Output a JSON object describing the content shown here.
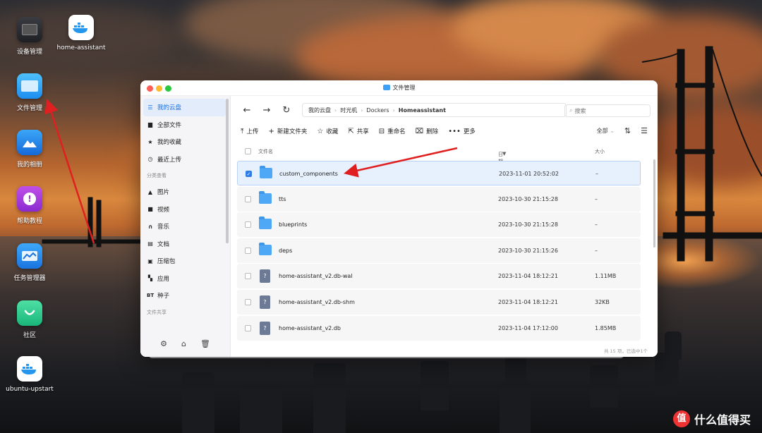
{
  "desktop": {
    "icons": [
      {
        "label": "设备管理"
      },
      {
        "label": "home-assistant"
      },
      {
        "label": "文件管理"
      },
      {
        "label": "我的相册"
      },
      {
        "label": "帮助教程"
      },
      {
        "label": "任务管理器"
      },
      {
        "label": "社区"
      },
      {
        "label": "ubuntu-upstart"
      }
    ]
  },
  "window": {
    "title": "文件管理",
    "sidebar": {
      "items": [
        {
          "label": "我的云盘",
          "icon": "list-icon"
        },
        {
          "label": "全部文件",
          "icon": "file-icon"
        },
        {
          "label": "我的收藏",
          "icon": "star-icon"
        },
        {
          "label": "最近上传",
          "icon": "clock-icon"
        }
      ],
      "section_category": "分类查看",
      "categories": [
        {
          "label": "图片",
          "icon": "image-icon"
        },
        {
          "label": "视频",
          "icon": "video-icon"
        },
        {
          "label": "音乐",
          "icon": "headphones-icon"
        },
        {
          "label": "文档",
          "icon": "document-icon"
        },
        {
          "label": "压缩包",
          "icon": "archive-icon"
        },
        {
          "label": "应用",
          "icon": "apps-icon"
        },
        {
          "label": "种子",
          "icon": "bt-icon",
          "glyph": "BT"
        }
      ],
      "section_share": "文件共享"
    },
    "breadcrumb": [
      "我的云盘",
      "时光机",
      "Dockers",
      "Homeassistant"
    ],
    "search": {
      "placeholder": "搜索"
    },
    "toolbar": {
      "upload": "上传",
      "new_folder": "新建文件夹",
      "favorite": "收藏",
      "share": "共享",
      "rename": "重命名",
      "delete": "删除",
      "more": "更多",
      "view_filter": "全部"
    },
    "columns": {
      "name": "文件名",
      "date": "日期",
      "size": "大小"
    },
    "files": [
      {
        "name": "custom_components",
        "date": "2023-11-01 20:52:02",
        "size": "–",
        "type": "folder",
        "selected": true
      },
      {
        "name": "tts",
        "date": "2023-10-30 21:15:28",
        "size": "–",
        "type": "folder",
        "selected": false
      },
      {
        "name": "blueprints",
        "date": "2023-10-30 21:15:28",
        "size": "–",
        "type": "folder",
        "selected": false
      },
      {
        "name": "deps",
        "date": "2023-10-30 21:15:26",
        "size": "–",
        "type": "folder",
        "selected": false
      },
      {
        "name": "home-assistant_v2.db-wal",
        "date": "2023-11-04 18:12:21",
        "size": "1.11MB",
        "type": "file",
        "selected": false
      },
      {
        "name": "home-assistant_v2.db-shm",
        "date": "2023-11-04 18:12:21",
        "size": "32KB",
        "type": "file",
        "selected": false
      },
      {
        "name": "home-assistant_v2.db",
        "date": "2023-11-04 17:12:00",
        "size": "1.85MB",
        "type": "file",
        "selected": false
      }
    ],
    "status": "共 15 项，已选中1个"
  },
  "watermark": {
    "text": "什么值得买",
    "glyph": "值"
  },
  "colors": {
    "accent": "#2f7ce8",
    "arrow": "#e02020",
    "folder": "#4fa8f5"
  }
}
